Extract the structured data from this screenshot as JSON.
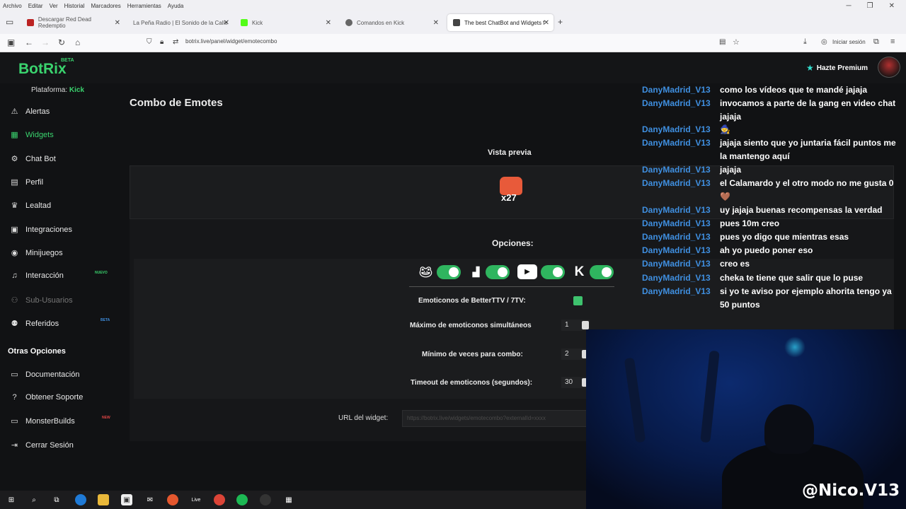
{
  "browser": {
    "menu": [
      "Archivo",
      "Editar",
      "Ver",
      "Historial",
      "Marcadores",
      "Herramientas",
      "Ayuda"
    ],
    "tabs": [
      {
        "label": "Descargar Red Dead Redemptio",
        "color": "#b22"
      },
      {
        "label": "La Peña Radio | El Sonido de la Calle",
        "color": "#888"
      },
      {
        "label": "Kick",
        "color": "#53fc18"
      },
      {
        "label": "Comandos en Kick",
        "color": "#666"
      },
      {
        "label": "The best ChatBot and Widgets f",
        "color": "#444"
      }
    ],
    "url": "botrix.live/panel/widget/emotecombo",
    "signin": "Iniciar sesión"
  },
  "header": {
    "logo": "BotRix",
    "beta": "BETA",
    "premium": "Hazte Premium"
  },
  "sidebar": {
    "platform_label": "Plataforma:",
    "platform_value": "Kick",
    "items": [
      {
        "label": "Alertas",
        "icon": "⚠"
      },
      {
        "label": "Widgets",
        "icon": "▦"
      },
      {
        "label": "Chat Bot",
        "icon": "⚙"
      },
      {
        "label": "Perfil",
        "icon": "▤"
      },
      {
        "label": "Lealtad",
        "icon": "♛"
      },
      {
        "label": "Integraciones",
        "icon": "▣"
      },
      {
        "label": "Minijuegos",
        "icon": "◉"
      },
      {
        "label": "Interacción",
        "icon": "♫"
      },
      {
        "label": "Sub-Usuarios",
        "icon": "⚇"
      },
      {
        "label": "Referidos",
        "icon": "⚉"
      }
    ],
    "badges": {
      "nuevo": "NUEVO",
      "beta": "BETA",
      "new": "NEW"
    },
    "other_title": "Otras Opciones",
    "other_items": [
      {
        "label": "Documentación",
        "icon": "▭"
      },
      {
        "label": "Obtener Soporte",
        "icon": "?"
      },
      {
        "label": "MonsterBuilds",
        "icon": "▭"
      },
      {
        "label": "Cerrar Sesión",
        "icon": "⇥"
      }
    ]
  },
  "main": {
    "title": "Combo de Emotes",
    "preview_label": "Vista previa",
    "combo_text": "x27",
    "options_label": "Opciones:",
    "platform_toggles": [
      {
        "platform": "kick",
        "enabled": true
      },
      {
        "platform": "twitch",
        "enabled": true
      },
      {
        "platform": "youtube",
        "enabled": true
      },
      {
        "platform": "kick-k",
        "enabled": true
      }
    ],
    "fields": {
      "betterttv_label": "Emoticonos de BetterTTV / 7TV:",
      "betterttv_checked": true,
      "max_label": "Máximo de emoticonos simultáneos",
      "max_value": "1",
      "min_label": "Mínimo de veces para combo:",
      "min_value": "2",
      "timeout_label": "Timeout de emoticonos (segundos):",
      "timeout_value": "30"
    },
    "url_label": "URL del widget:",
    "url_value": "https://botrix.live/widgets/emotecombo?externalId=xxxx"
  },
  "chat": {
    "user_color": "#3f8fe0",
    "messages": [
      {
        "user": "DanyMadrid_V13",
        "text": "como los vídeos que te mandé jajaja"
      },
      {
        "user": "DanyMadrid_V13",
        "text": "invocamos a parte de la gang en video chat jajaja"
      },
      {
        "user": "DanyMadrid_V13",
        "text": "🧙"
      },
      {
        "user": "DanyMadrid_V13",
        "text": "jajaja siento que yo juntaria fácil puntos me la mantengo aquí"
      },
      {
        "user": "DanyMadrid_V13",
        "text": "jajaja"
      },
      {
        "user": "DanyMadrid_V13",
        "text": "el Calamardo y el otro modo no me gusta 0 🤎"
      },
      {
        "user": "DanyMadrid_V13",
        "text": "uy jajaja buenas recompensas la verdad"
      },
      {
        "user": "DanyMadrid_V13",
        "text": "pues 10m creo"
      },
      {
        "user": "DanyMadrid_V13",
        "text": "pues yo digo que mientras esas"
      },
      {
        "user": "DanyMadrid_V13",
        "text": "ah yo puedo poner eso"
      },
      {
        "user": "DanyMadrid_V13",
        "text": "creo es"
      },
      {
        "user": "DanyMadrid_V13",
        "text": "cheka te tiene que salir que lo puse"
      },
      {
        "user": "DanyMadrid_V13",
        "text": "si yo te aviso por ejemplo ahorita tengo ya 50 puntos"
      }
    ]
  },
  "overlay": {
    "handle": "@Nico.V13"
  },
  "colors": {
    "accent": "#3ad36e",
    "toggle_on": "#2fb55f",
    "panel": "#1b1c1e"
  }
}
